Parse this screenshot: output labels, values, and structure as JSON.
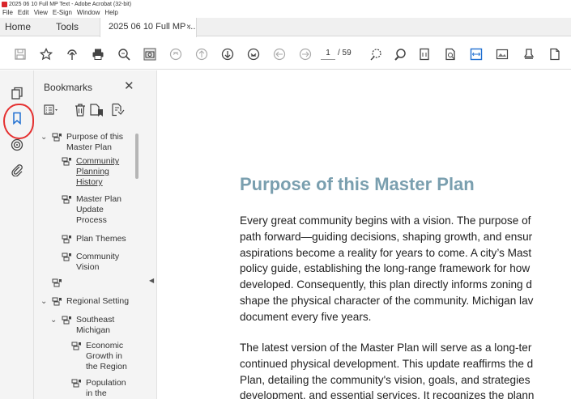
{
  "window": {
    "title": "2025 06 10 Full MP Text - Adobe Acrobat (32-bit)"
  },
  "menu": [
    "File",
    "Edit",
    "View",
    "E-Sign",
    "Window",
    "Help"
  ],
  "tabs": {
    "home": "Home",
    "tools": "Tools",
    "doc": "2025 06 10 Full MP ...",
    "close": "×"
  },
  "toolbar": {
    "page_current": "1",
    "page_total": "/ 59"
  },
  "bookmarks": {
    "header": "Bookmarks",
    "close": "✕",
    "items": [
      {
        "lines": [
          "Purpose of this",
          "Master Plan"
        ],
        "link": false
      },
      {
        "lines": [
          "Community",
          "Planning",
          "History"
        ],
        "link": true
      },
      {
        "lines": [
          "Master Plan",
          "Update",
          "Process"
        ],
        "link": false
      },
      {
        "lines": [
          "Plan Themes"
        ],
        "link": false
      },
      {
        "lines": [
          "Community",
          "Vision"
        ],
        "link": false
      },
      {
        "lines": [
          ""
        ],
        "link": false
      },
      {
        "lines": [
          "Regional Setting"
        ],
        "link": false
      },
      {
        "lines": [
          "Southeast",
          "Michigan"
        ],
        "link": false
      },
      {
        "lines": [
          "Economic",
          "Growth in",
          "the Region"
        ],
        "link": false
      },
      {
        "lines": [
          "Population",
          "in the"
        ],
        "link": false
      }
    ]
  },
  "document": {
    "title": "Purpose of this Master Plan",
    "para1": [
      "Every great community begins with a vision. The purpose of",
      "path forward—guiding decisions, shaping growth, and ensur",
      "aspirations become a reality for years to come. A city’s Mast",
      "policy guide, establishing the long-range framework for how",
      "developed. Consequently, this plan directly informs zoning d",
      "shape the physical character of the community. Michigan lav",
      "document every five years."
    ],
    "para2": [
      "The latest version of the Master Plan will serve as a long-ter",
      "continued physical development. This update reaffirms the d",
      "Plan, detailing the community's vision, goals, and strategies",
      "development, and essential services. It recognizes the plann"
    ]
  },
  "colors": {
    "heading": "#7a9faf",
    "annotation_ring": "#e53030",
    "toolbar_accent": "#1f6fd1"
  }
}
